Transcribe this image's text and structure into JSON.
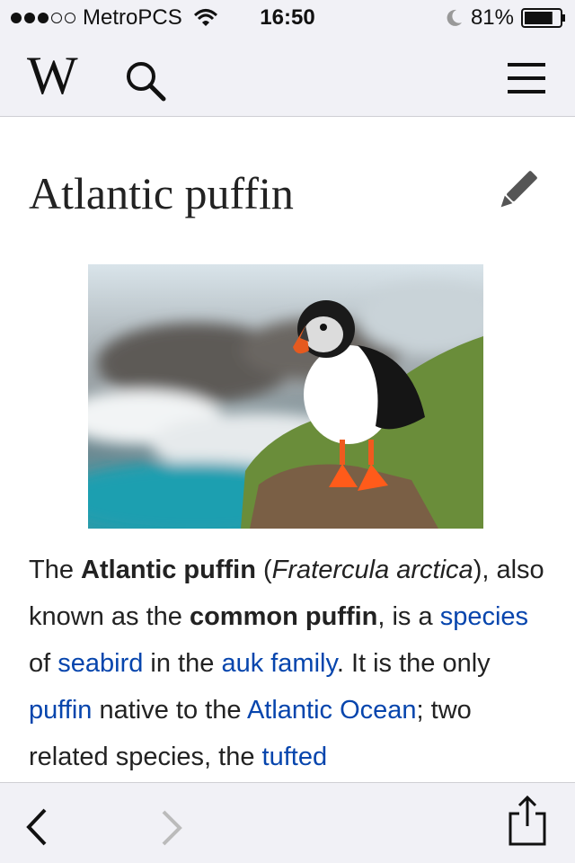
{
  "status": {
    "carrier": "MetroPCS",
    "time": "16:50",
    "battery": "81%",
    "battery_level": 0.81
  },
  "nav": {
    "logo_text": "W"
  },
  "article": {
    "title": "Atlantic puffin",
    "image_alt": "Atlantic puffin standing on a grassy cliff edge",
    "p1": {
      "t1": "The ",
      "b1": "Atlantic puffin",
      "t2": " (",
      "i1": "Fratercula arctica",
      "t3": "), also known as the ",
      "b2": "common puffin",
      "t4": ", is a ",
      "l1": "species",
      "t5": " of ",
      "l2": "seabird",
      "t6": " in the ",
      "l3": "auk family",
      "t7": ". It is the only ",
      "l4": "puffin",
      "t8": " native to the ",
      "l5": "Atlantic Ocean",
      "t9": "; two related species, the ",
      "l6": "tufted"
    }
  },
  "icons": {
    "search": "search-icon",
    "menu": "hamburger-menu-icon",
    "edit": "pencil-icon",
    "back": "chevron-left-icon",
    "forward": "chevron-right-icon",
    "share": "share-icon"
  },
  "colors": {
    "link": "#0645ad",
    "bar_background": "#f1f1f6"
  }
}
